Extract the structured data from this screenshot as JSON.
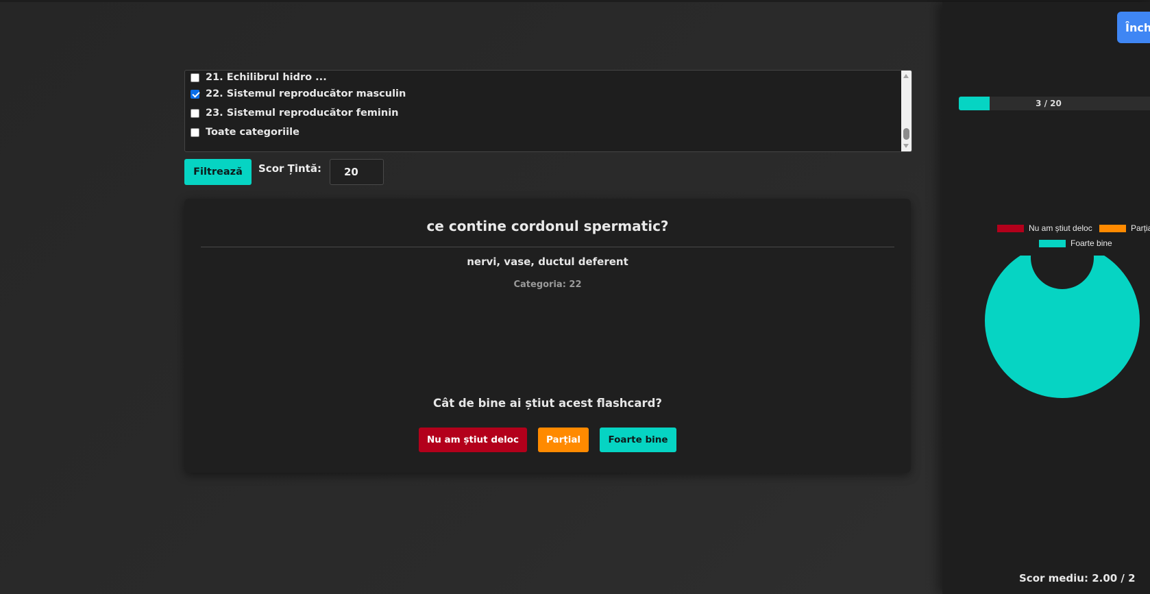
{
  "categories": {
    "items": [
      {
        "label": "21. Echilibrul hidro ...",
        "checked": false
      },
      {
        "label": "22. Sistemul reproducător masculin",
        "checked": true
      },
      {
        "label": "23. Sistemul reproducător feminin",
        "checked": false
      },
      {
        "label": "Toate categoriile",
        "checked": false
      }
    ]
  },
  "filters": {
    "filter_label": "Filtrează",
    "target_label": "Scor Țintă:",
    "target_value": "20"
  },
  "card": {
    "question": "ce contine cordonul spermatic?",
    "answer": "nervi, vase, ductul deferent",
    "category": "Categoria: 22",
    "rating_question": "Cât de bine ai știut acest flashcard?",
    "buttons": {
      "none": "Nu am știut deloc",
      "partial": "Parțial",
      "good": "Foarte bine"
    }
  },
  "panel": {
    "close_label": "Închide",
    "progress": {
      "text": "3 / 20",
      "current": 3,
      "total": 20
    },
    "avg_score": "Scor mediu: 2.00 / 2"
  },
  "colors": {
    "red": "#b3001b",
    "orange": "#ff8a00",
    "teal": "#06d4c3",
    "blue": "#3f86f4"
  },
  "chart_data": {
    "type": "pie",
    "variant": "doughnut",
    "labels": [
      "Nu am știut deloc",
      "Parțial",
      "Foarte bine"
    ],
    "values": [
      0,
      0,
      3
    ],
    "colors": [
      "#b3001b",
      "#ff8a00",
      "#06d4c3"
    ],
    "legend": "top"
  }
}
